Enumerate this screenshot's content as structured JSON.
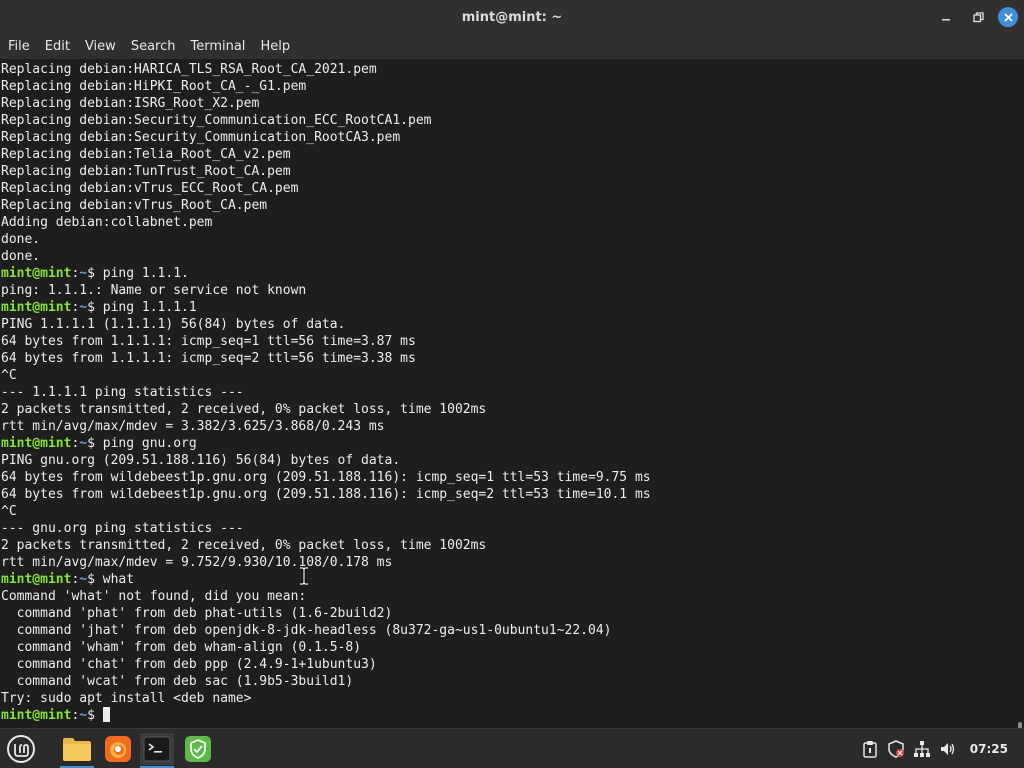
{
  "window": {
    "title": "mint@mint: ~"
  },
  "menu": [
    "File",
    "Edit",
    "View",
    "Search",
    "Terminal",
    "Help"
  ],
  "prompt": {
    "user": "mint@mint",
    "path": "~",
    "symbol": "$ "
  },
  "lines": [
    {
      "text": "Replacing debian:HARICA_TLS_RSA_Root_CA_2021.pem"
    },
    {
      "text": "Replacing debian:HiPKI_Root_CA_-_G1.pem"
    },
    {
      "text": "Replacing debian:ISRG_Root_X2.pem"
    },
    {
      "text": "Replacing debian:Security_Communication_ECC_RootCA1.pem"
    },
    {
      "text": "Replacing debian:Security_Communication_RootCA3.pem"
    },
    {
      "text": "Replacing debian:Telia_Root_CA_v2.pem"
    },
    {
      "text": "Replacing debian:TunTrust_Root_CA.pem"
    },
    {
      "text": "Replacing debian:vTrus_ECC_Root_CA.pem"
    },
    {
      "text": "Replacing debian:vTrus_Root_CA.pem"
    },
    {
      "text": "Adding debian:collabnet.pem"
    },
    {
      "text": "done."
    },
    {
      "text": "done."
    },
    {
      "cmd": "ping 1.1.1."
    },
    {
      "text": "ping: 1.1.1.: Name or service not known"
    },
    {
      "cmd": "ping 1.1.1.1"
    },
    {
      "text": "PING 1.1.1.1 (1.1.1.1) 56(84) bytes of data."
    },
    {
      "text": "64 bytes from 1.1.1.1: icmp_seq=1 ttl=56 time=3.87 ms"
    },
    {
      "text": "64 bytes from 1.1.1.1: icmp_seq=2 ttl=56 time=3.38 ms"
    },
    {
      "text": "^C"
    },
    {
      "text": "--- 1.1.1.1 ping statistics ---"
    },
    {
      "text": "2 packets transmitted, 2 received, 0% packet loss, time 1002ms"
    },
    {
      "text": "rtt min/avg/max/mdev = 3.382/3.625/3.868/0.243 ms"
    },
    {
      "cmd": "ping gnu.org"
    },
    {
      "text": "PING gnu.org (209.51.188.116) 56(84) bytes of data."
    },
    {
      "text": "64 bytes from wildebeest1p.gnu.org (209.51.188.116): icmp_seq=1 ttl=53 time=9.75 ms"
    },
    {
      "text": "64 bytes from wildebeest1p.gnu.org (209.51.188.116): icmp_seq=2 ttl=53 time=10.1 ms"
    },
    {
      "text": "^C"
    },
    {
      "text": "--- gnu.org ping statistics ---"
    },
    {
      "text": "2 packets transmitted, 2 received, 0% packet loss, time 1002ms"
    },
    {
      "text": "rtt min/avg/max/mdev = 9.752/9.930/10.108/0.178 ms"
    },
    {
      "cmd": "what"
    },
    {
      "text": "Command 'what' not found, did you mean:"
    },
    {
      "text": "  command 'phat' from deb phat-utils (1.6-2build2)"
    },
    {
      "text": "  command 'jhat' from deb openjdk-8-jdk-headless (8u372-ga~us1-0ubuntu1~22.04)"
    },
    {
      "text": "  command 'wham' from deb wham-align (0.1.5-8)"
    },
    {
      "text": "  command 'chat' from deb ppp (2.4.9-1+1ubuntu3)"
    },
    {
      "text": "  command 'wcat' from deb sac (1.9b5-3build1)"
    },
    {
      "text": "Try: sudo apt install <deb name>"
    },
    {
      "cmd": "",
      "cursor": true
    }
  ],
  "taskbar": {
    "items": [
      {
        "name": "mint-menu-icon"
      },
      {
        "name": "files-icon"
      },
      {
        "name": "firefox-icon"
      },
      {
        "name": "terminal-icon",
        "active": true
      },
      {
        "name": "update-manager-shield-icon"
      }
    ],
    "tray": [
      "clipboard-icon",
      "shield-icon",
      "network-icon",
      "volume-icon"
    ],
    "clock": "07:25"
  },
  "colors": {
    "prompt_user": "#8ae234",
    "prompt_path": "#729fcf",
    "accent": "#3d8fd6",
    "terminal_bg": "#1e1e1e"
  }
}
